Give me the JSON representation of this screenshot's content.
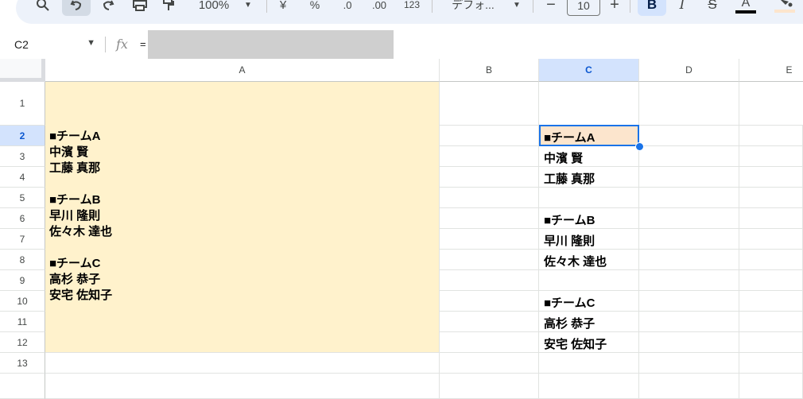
{
  "toolbar": {
    "zoom": "100%",
    "currency": "¥",
    "percent": "%",
    "dec_decrease": ".0",
    "dec_increase": ".00",
    "number_format": "123",
    "font": "デフォ...",
    "minus": "−",
    "font_size": "10",
    "plus": "+",
    "bold": "B",
    "italic": "I",
    "strike": "S",
    "text_color": "A"
  },
  "formula_bar": {
    "cell_ref": "C2",
    "fx": "fx",
    "eq": "="
  },
  "columns": [
    "A",
    "B",
    "C",
    "D",
    "E"
  ],
  "rows": [
    "1",
    "2",
    "3",
    "4",
    "5",
    "6",
    "7",
    "8",
    "9",
    "10",
    "11",
    "12",
    "13"
  ],
  "merged_text": [
    "■チームA",
    "中濱 賢",
    "工藤 真那",
    "",
    "■チームB",
    "早川 隆則",
    "佐々木 達也",
    "",
    "■チームC",
    "高杉 恭子",
    "安宅 佐知子"
  ],
  "column_c": {
    "r2": "■チームA",
    "r3": "中濱 賢",
    "r4": "工藤 真那",
    "r6": "■チームB",
    "r7": "早川 隆則",
    "r8": "佐々木 達也",
    "r10": "■チームC",
    "r11": "高杉 恭子",
    "r12": "安宅 佐知子"
  },
  "colors": {
    "merged_fill": "#fff2cc",
    "selected_fill": "#fce5cd",
    "selection": "#1a73e8",
    "header_sel": "#d3e3fd"
  }
}
